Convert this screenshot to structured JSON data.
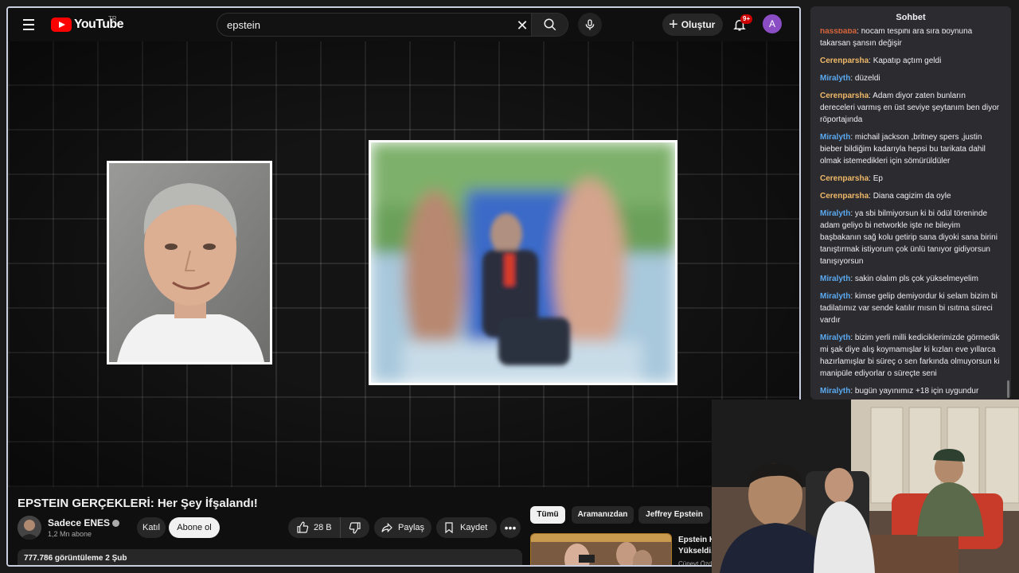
{
  "header": {
    "logo_text": "YouTube",
    "region": "TR",
    "search_value": "epstein",
    "create_label": "Oluştur",
    "notifications_badge": "9+",
    "avatar_letter": "A"
  },
  "video": {
    "title": "EPSTEIN GERÇEKLERİ: Her Şey İfşalandı!"
  },
  "channel": {
    "name": "Sadece ENES",
    "subscribers": "1,2 Mn abone",
    "join_label": "Katıl",
    "subscribe_label": "Abone ol"
  },
  "actions": {
    "likes": "28 B",
    "share_label": "Paylaş",
    "save_label": "Kaydet",
    "more_label": "•••"
  },
  "description": {
    "meta": "777.786 görüntüleme  2 Şub"
  },
  "chips": [
    "Tümü",
    "Aramanızdan",
    "Jeffrey Epstein"
  ],
  "recommendation": {
    "title_line1": "Epstein K",
    "title_line2": "Yükseldi,",
    "channel": "Cünevt Özd"
  },
  "chat": {
    "title": "Sohbet",
    "messages": [
      {
        "user": "hassbaba",
        "color": "#d6643a",
        "text": "hocam tespihi ara sıra boynuna takarsan şansın değişir"
      },
      {
        "user": "Cerenparsha",
        "color": "#f0b968",
        "text": "Kapatıp açtım geldi"
      },
      {
        "user": "Miralyth",
        "color": "#5aa9f0",
        "text": "düzeldi"
      },
      {
        "user": "Cerenparsha",
        "color": "#f0b968",
        "text": "Adam diyor zaten bunların dereceleri varmış en üst seviye şeytanım ben diyor röportajında"
      },
      {
        "user": "Miralyth",
        "color": "#5aa9f0",
        "text": "michail jackson ,britney spers ,justin bieber bildiğim kadarıyla hepsi bu tarikata dahil olmak istemedikleri için sömürüldüler"
      },
      {
        "user": "Cerenparsha",
        "color": "#f0b968",
        "text": "Ep"
      },
      {
        "user": "Cerenparsha",
        "color": "#f0b968",
        "text": "Diana cagizim da oyle"
      },
      {
        "user": "Miralyth",
        "color": "#5aa9f0",
        "text": "ya sbi bilmiyorsun ki bi ödül töreninde adam geliyo bi networkle işte ne bileyim başbakanın sağ kolu getirip sana diyoki sana birini tanıştırmak istiyorum çok ünlü tanıyor gidiyorsun tanışıyorsun"
      },
      {
        "user": "Miralyth",
        "color": "#5aa9f0",
        "text": "sakin olalım pls çok yükselmeyelim"
      },
      {
        "user": "Miralyth",
        "color": "#5aa9f0",
        "text": "kimse gelip demiyordur ki selam bizim bi tadilatımız var sende katılır mısın bi ısıtma süreci vardır"
      },
      {
        "user": "Miralyth",
        "color": "#5aa9f0",
        "text": "bizim yerli milli kediciklerimizde görmedik mi şak diye alış koymamışlar ki kızları eve yıllarca hazırlamışlar bi süreç o sen farkında olmuyorsun ki manipüle ediyorlar o süreçte seni"
      },
      {
        "user": "Miralyth",
        "color": "#5aa9f0",
        "text": "bugün yayınımız +18 için uygundur"
      }
    ]
  }
}
